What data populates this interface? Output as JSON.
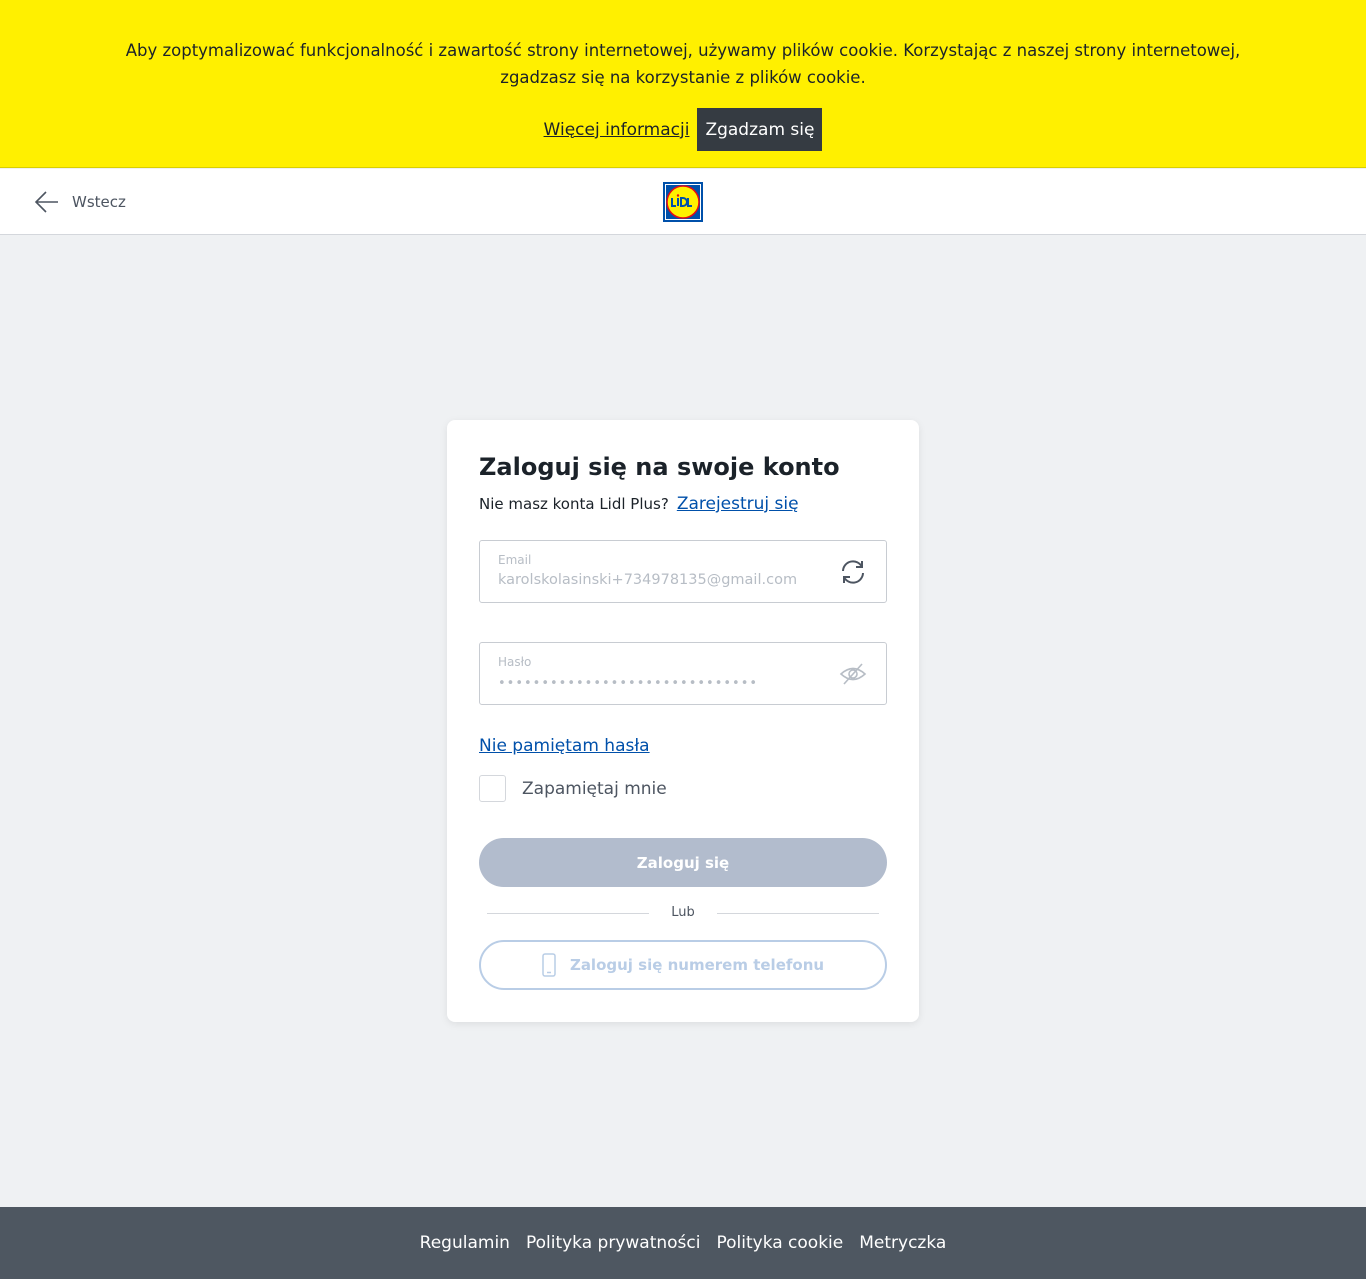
{
  "cookie_banner": {
    "text_line1": "Aby zoptymalizować funkcjonalność i zawartość strony internetowej, używamy plików cookie. Korzystając z naszej strony internetowej,",
    "text_line2": "zgadzasz się na korzystanie z plików cookie.",
    "more_info_label": "Więcej informacji",
    "accept_label": "Zgadzam się",
    "background_color": "#fff000"
  },
  "header": {
    "back_label": "Wstecz",
    "back_icon": "arrow-left-icon",
    "logo": "lidl-logo"
  },
  "login": {
    "title": "Zaloguj się na swoje konto",
    "no_account_text": "Nie masz konta Lidl Plus?",
    "register_label": "Zarejestruj się",
    "email": {
      "label": "Email",
      "value": "karolskolasinski+734978135@gmail.com",
      "icon": "refresh-icon"
    },
    "password": {
      "label": "Hasło",
      "value": "••••••••••••••••••••••••••••••",
      "icon": "eye-off-icon"
    },
    "forgot_password_label": "Nie pamiętam hasła",
    "remember_me_label": "Zapamiętaj mnie",
    "remember_me_checked": false,
    "login_button_label": "Zaloguj się",
    "divider_text": "Lub",
    "phone_login_label": "Zaloguj się numerem telefonu",
    "phone_icon": "smartphone-icon",
    "link_color": "#0050aa"
  },
  "footer": {
    "links": [
      "Regulamin",
      "Polityka prywatności",
      "Polityka cookie",
      "Metryczka"
    ],
    "background_color": "#4e5761"
  }
}
